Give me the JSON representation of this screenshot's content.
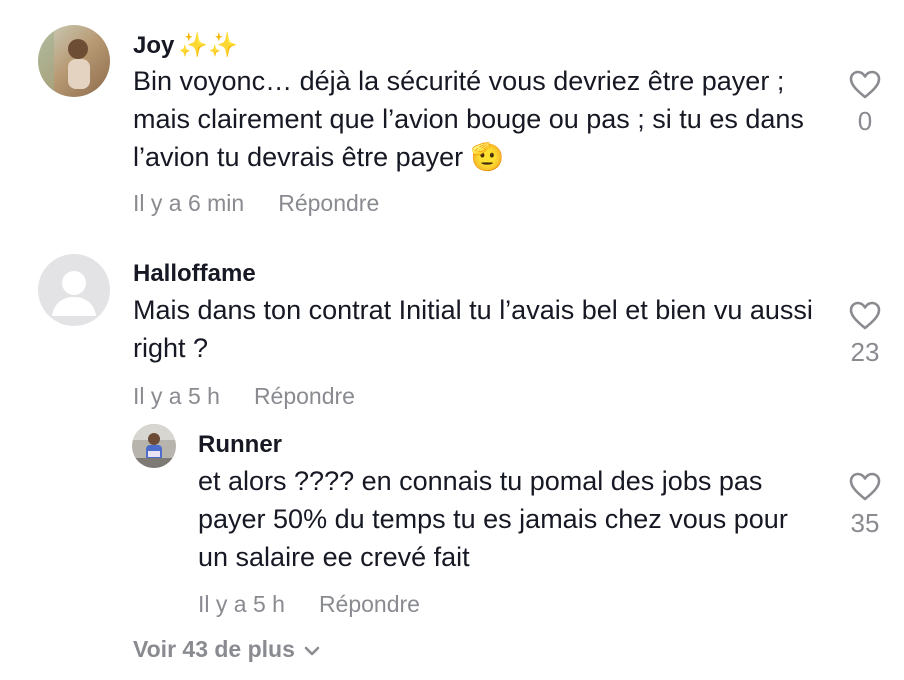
{
  "comments": [
    {
      "username": "Joy",
      "badge": "✨✨",
      "text": "Bin voyonc… déjà la sécurité vous devriez être payer ; mais clairement que l’avion bouge ou pas ; si tu es dans l’avion tu devrais être payer 🫡",
      "time": "Il y a 6 min",
      "reply_label": "Répondre",
      "likes": "0"
    },
    {
      "username": "Halloffame",
      "text": "Mais dans ton contrat Initial tu l’avais bel et bien vu aussi right ?",
      "time": "Il y a 5 h",
      "reply_label": "Répondre",
      "likes": "23"
    },
    {
      "username": "Runner",
      "text": "et alors ???? en connais tu pomal des jobs pas payer 50% du temps tu es jamais chez vous pour un salaire ee crevé fait",
      "time": "Il y a 5 h",
      "reply_label": "Répondre",
      "likes": "35"
    }
  ],
  "more_replies_label": "Voir 43 de plus",
  "colors": {
    "text": "#161823",
    "muted": "#8a8b91"
  }
}
